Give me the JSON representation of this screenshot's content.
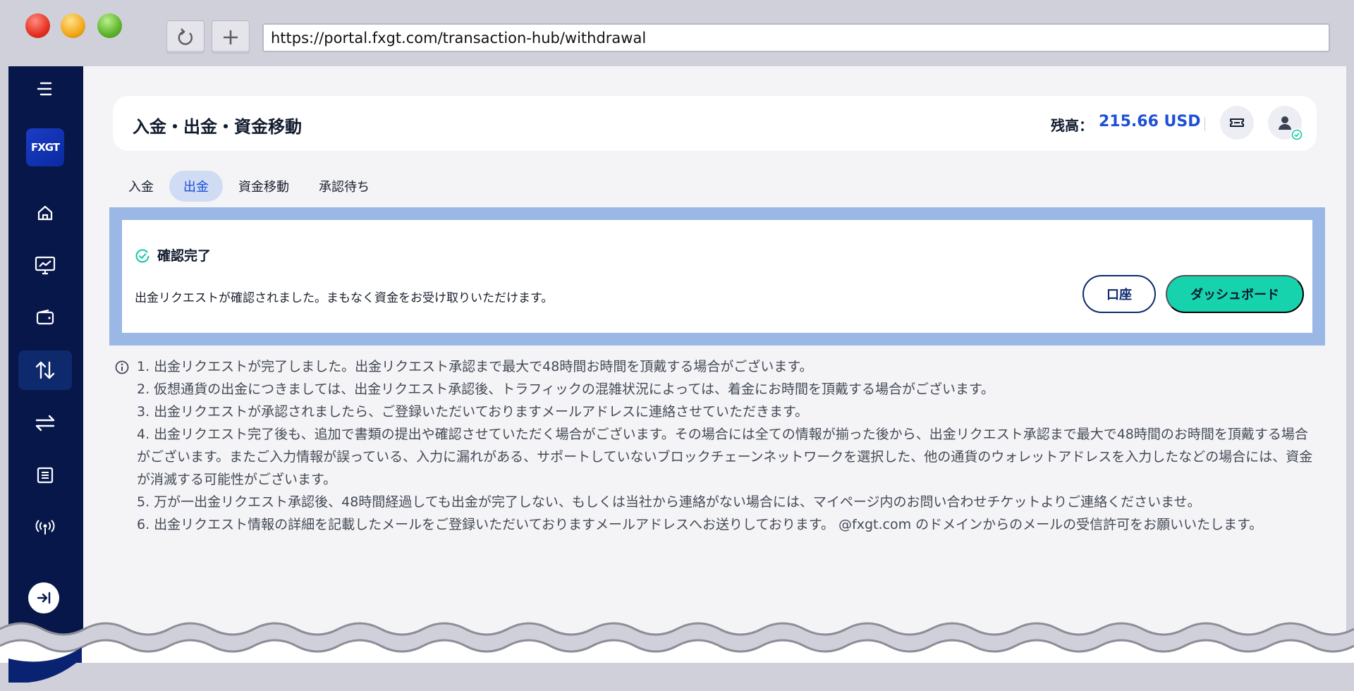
{
  "browser": {
    "url": "https://portal.fxgt.com/transaction-hub/withdrawal",
    "reload_icon": "reload-icon",
    "new_tab_icon": "plus-icon"
  },
  "sidebar": {
    "logo_text": "FXGT",
    "items": [
      {
        "name": "menu",
        "icon": "hamburger-icon"
      },
      {
        "name": "home",
        "icon": "home-icon"
      },
      {
        "name": "trading",
        "icon": "chart-monitor-icon"
      },
      {
        "name": "wallet",
        "icon": "wallet-icon"
      },
      {
        "name": "transactions",
        "icon": "arrows-updown-icon",
        "active": true
      },
      {
        "name": "transfer",
        "icon": "arrows-swap-icon"
      },
      {
        "name": "history",
        "icon": "list-icon"
      },
      {
        "name": "support",
        "icon": "signal-icon"
      }
    ],
    "collapse_icon": "collapse-right-icon"
  },
  "header": {
    "title": "入金・出金・資金移動",
    "balance_label": "残高：",
    "balance_value": "215.66 USD"
  },
  "tabs": [
    {
      "label": "入金",
      "active": false
    },
    {
      "label": "出金",
      "active": true
    },
    {
      "label": "資金移動",
      "active": false
    },
    {
      "label": "承認待ち",
      "active": false
    }
  ],
  "confirmation": {
    "title": "確認完了",
    "message": "出金リクエストが確認されました。まもなく資金をお受け取りいただけます。",
    "account_button": "口座",
    "dashboard_button": "ダッシュボード"
  },
  "notes": [
    "1. 出金リクエストが完了しました。出金リクエスト承認まで最大で48時間お時間を頂戴する場合がございます。",
    "2. 仮想通貨の出金につきましては、出金リクエスト承認後、トラフィックの混雑状況によっては、着金にお時間を頂戴する場合がございます。",
    "3. 出金リクエストが承認されましたら、ご登録いただいておりますメールアドレスに連絡させていただきます。",
    "4. 出金リクエスト完了後も、追加で書類の提出や確認させていただく場合がございます。その場合には全ての情報が揃った後から、出金リクエスト承認まで最大で48時間のお時間を頂戴する場合がございます。またご入力情報が誤っている、入力に漏れがある、サポートしていないブロックチェーンネットワークを選択した、他の通貨のウォレットアドレスを入力したなどの場合には、資金が消滅する可能性がございます。",
    "5. 万が一出金リクエスト承認後、48時間経過しても出金が完了しない、もしくは当社から連絡がない場合には、マイページ内のお問い合わせチケットよりご連絡くださいませ。",
    "6. 出金リクエスト情報の詳細を記載したメールをご登録いただいておりますメールアドレスへお送りしております。 @fxgt.com のドメインからのメールの受信許可をお願いいたします。"
  ],
  "colors": {
    "sidebar_bg": "#07174a",
    "accent_blue": "#1d4fd6",
    "accent_green": "#17d3ad",
    "panel_border": "#9ab7e6"
  }
}
